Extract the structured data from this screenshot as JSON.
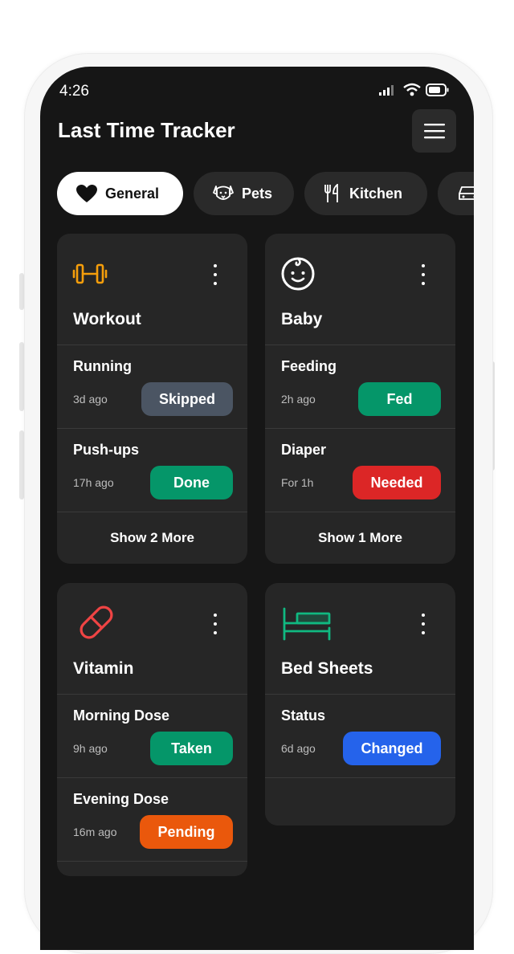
{
  "status_bar": {
    "time": "4:26"
  },
  "header": {
    "title": "Last Time Tracker",
    "menu_icon": "hamburger-icon"
  },
  "categories": [
    {
      "label": "General",
      "icon": "heart-icon",
      "active": true
    },
    {
      "label": "Pets",
      "icon": "dog-icon",
      "active": false
    },
    {
      "label": "Kitchen",
      "icon": "fork-knife-icon",
      "active": false
    },
    {
      "label": "",
      "icon": "car-icon",
      "active": false
    }
  ],
  "cards": [
    {
      "title": "Workout",
      "icon": "dumbbell-icon",
      "icon_color": "#f59e0b",
      "items": [
        {
          "name": "Running",
          "ago": "3d ago",
          "status": "Skipped",
          "color": "#4b5563"
        },
        {
          "name": "Push-ups",
          "ago": "17h ago",
          "status": "Done",
          "color": "#059669"
        }
      ],
      "more": "Show 2 More"
    },
    {
      "title": "Baby",
      "icon": "baby-face-icon",
      "icon_color": "#ffffff",
      "items": [
        {
          "name": "Feeding",
          "ago": "2h ago",
          "status": "Fed",
          "color": "#059669"
        },
        {
          "name": "Diaper",
          "ago": "For 1h",
          "status": "Needed",
          "color": "#dc2626"
        }
      ],
      "more": "Show 1 More"
    },
    {
      "title": "Vitamin",
      "icon": "pill-icon",
      "icon_color": "#ef4444",
      "items": [
        {
          "name": "Morning Dose",
          "ago": "9h ago",
          "status": "Taken",
          "color": "#059669"
        },
        {
          "name": "Evening Dose",
          "ago": "16m ago",
          "status": "Pending",
          "color": "#ea580c"
        }
      ],
      "more": ""
    },
    {
      "title": "Bed Sheets",
      "icon": "bed-icon",
      "icon_color": "#10b981",
      "items": [
        {
          "name": "Status",
          "ago": "6d ago",
          "status": "Changed",
          "color": "#2563eb"
        }
      ],
      "more": ""
    }
  ]
}
